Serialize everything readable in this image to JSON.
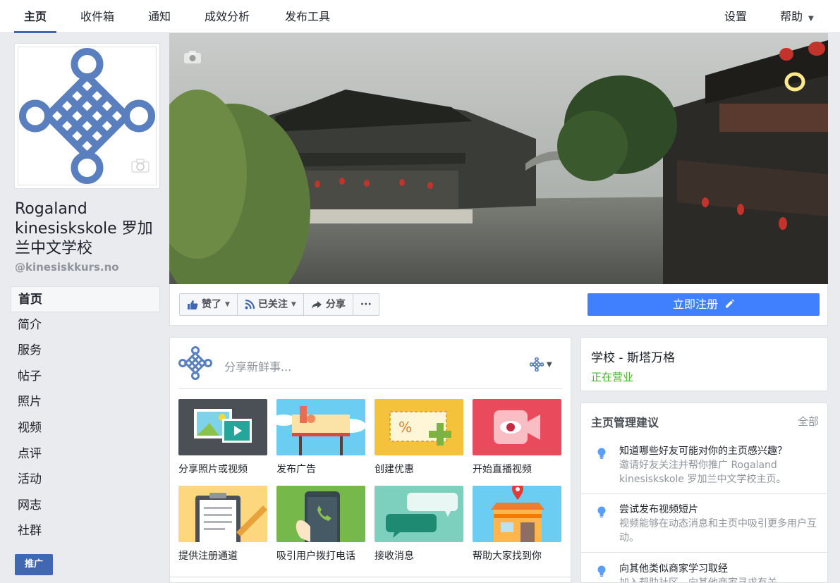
{
  "topnav": {
    "tabs": [
      "主页",
      "收件箱",
      "通知",
      "成效分析",
      "发布工具"
    ],
    "settings": "设置",
    "help": "帮助",
    "help_caret": "▼"
  },
  "page": {
    "name": "Rogaland kinesiskskole 罗加兰中文学校",
    "handle": "@kinesiskkurs.no"
  },
  "leftnav": [
    "首页",
    "简介",
    "服务",
    "帖子",
    "照片",
    "视频",
    "点评",
    "活动",
    "网志",
    "社群"
  ],
  "promote": "推广",
  "actions": {
    "liked": "赞了",
    "following": "已关注",
    "share": "分享",
    "more": "···",
    "signup": "立即注册"
  },
  "composer": {
    "placeholder": "分享新鲜事...",
    "tiles": [
      {
        "label": "分享照片或视频",
        "color": "#4b4f56"
      },
      {
        "label": "发布广告",
        "color": "#6bcdf2"
      },
      {
        "label": "创建优惠",
        "color": "#f5c33b"
      },
      {
        "label": "开始直播视频",
        "color": "#e94b5c"
      },
      {
        "label": "提供注册通道",
        "color": "#fdd77e"
      },
      {
        "label": "吸引用户拨打电话",
        "color": "#77b84a"
      },
      {
        "label": "接收消息",
        "color": "#7cd0bd"
      },
      {
        "label": "帮助大家找到你",
        "color": "#6bcdf2"
      }
    ]
  },
  "info": {
    "category": "学校 - 斯塔万格",
    "status": "正在营业"
  },
  "suggestions": {
    "title": "主页管理建议",
    "all": "全部",
    "items": [
      {
        "title": "知道哪些好友可能对你的主页感兴趣？",
        "desc": "邀请好友关注并帮你推广 Rogaland kinesiskskole 罗加兰中文学校主页。"
      },
      {
        "title": "尝试发布视频短片",
        "desc": "视频能够在动态消息和主页中吸引更多用户互动。"
      },
      {
        "title": "向其他类似商家学习取经",
        "desc": "加入帮助社区，向其他商家寻求有关"
      }
    ]
  },
  "colors": {
    "brand": "#4267b2",
    "cta": "#4080ff",
    "open": "#42b72a",
    "knot": "#5a7fbf"
  }
}
